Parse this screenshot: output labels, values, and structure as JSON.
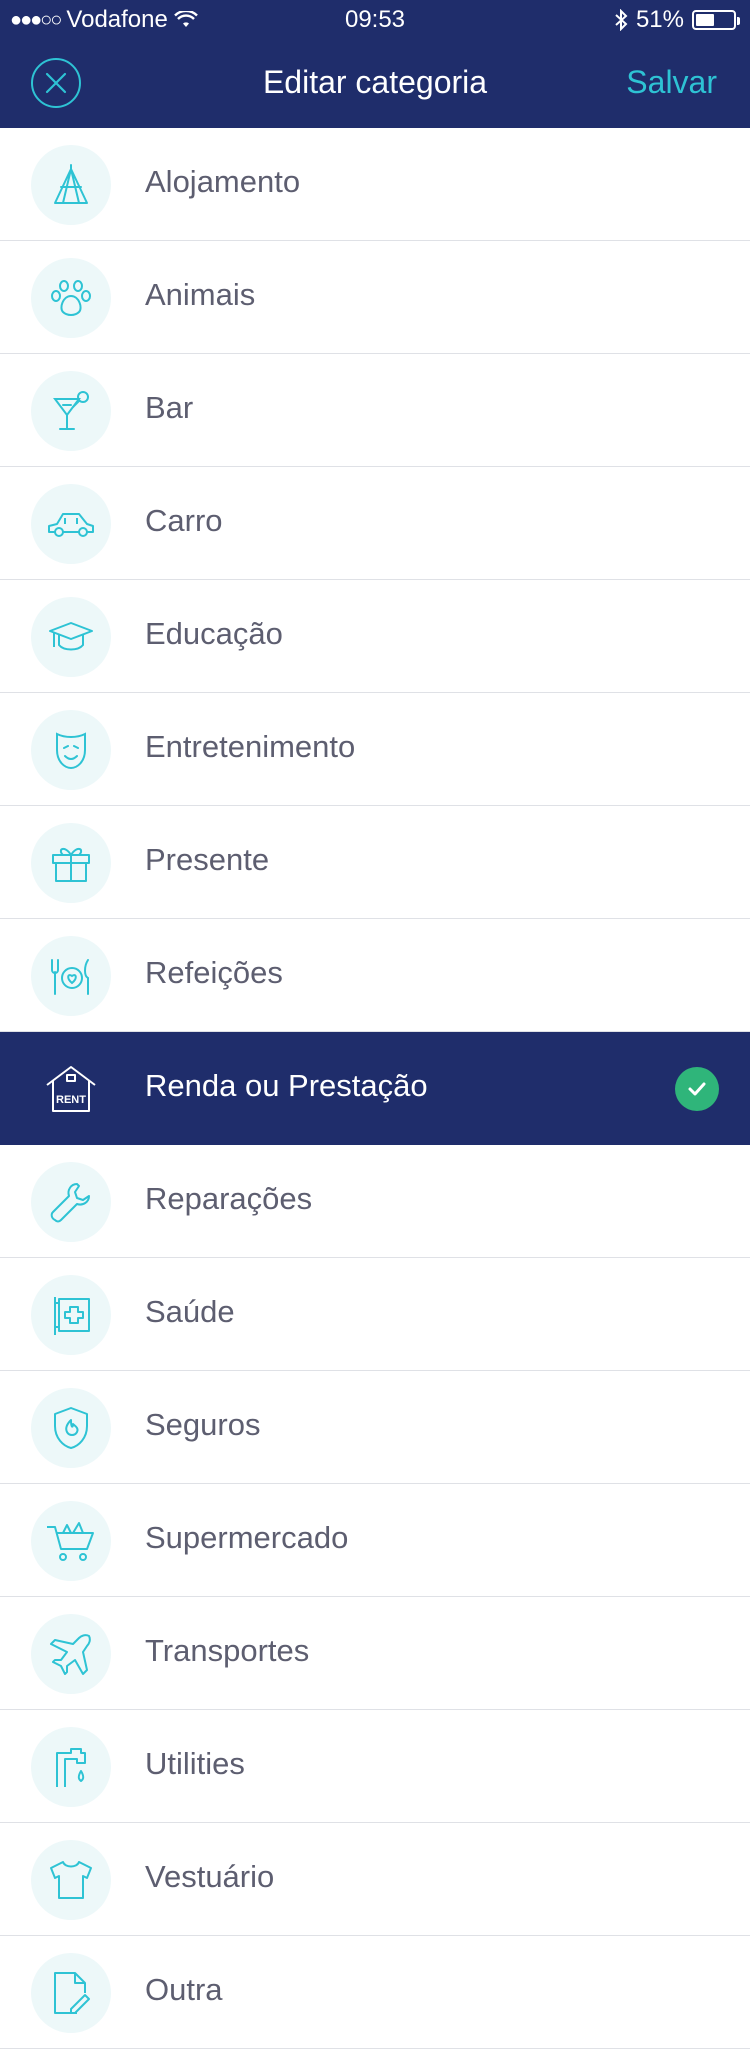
{
  "status_bar": {
    "carrier": "Vodafone",
    "time": "09:53",
    "battery": "51%",
    "battery_level": 0.51
  },
  "nav": {
    "title": "Editar categoria",
    "save_label": "Salvar"
  },
  "colors": {
    "header_bg": "#1f2d6b",
    "accent": "#2ec3d4",
    "icon_bg": "#edf8f9",
    "label": "#5d5e70",
    "check": "#2fb57a"
  },
  "categories": [
    {
      "label": "Alojamento",
      "icon": "tent-icon"
    },
    {
      "label": "Animais",
      "icon": "paw-icon"
    },
    {
      "label": "Bar",
      "icon": "cocktail-icon"
    },
    {
      "label": "Carro",
      "icon": "car-icon"
    },
    {
      "label": "Educação",
      "icon": "graduation-cap-icon"
    },
    {
      "label": "Entretenimento",
      "icon": "theater-mask-icon"
    },
    {
      "label": "Presente",
      "icon": "gift-icon"
    },
    {
      "label": "Refeições",
      "icon": "plate-cutlery-icon"
    },
    {
      "label": "Renda ou Prestação",
      "icon": "house-rent-icon",
      "selected": true,
      "icon_text": "RENT"
    },
    {
      "label": "Reparações",
      "icon": "wrench-icon"
    },
    {
      "label": "Saúde",
      "icon": "pharmacy-sign-icon"
    },
    {
      "label": "Seguros",
      "icon": "shield-icon"
    },
    {
      "label": "Supermercado",
      "icon": "shopping-cart-icon"
    },
    {
      "label": "Transportes",
      "icon": "airplane-icon"
    },
    {
      "label": "Utilities",
      "icon": "faucet-icon"
    },
    {
      "label": "Vestuário",
      "icon": "tshirt-icon"
    },
    {
      "label": "Outra",
      "icon": "document-edit-icon"
    }
  ]
}
